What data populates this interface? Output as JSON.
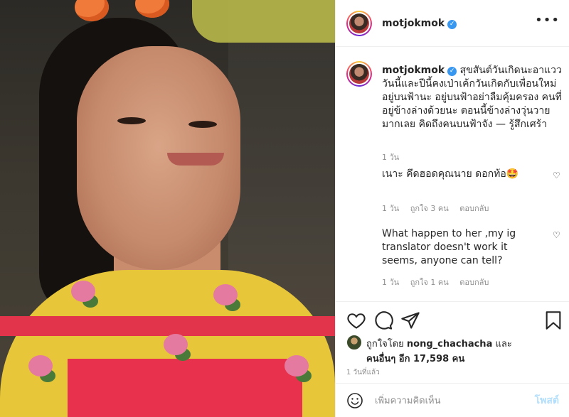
{
  "post": {
    "username": "motjokmok",
    "verified": true,
    "more_icon": "more-horizontal-icon"
  },
  "caption": {
    "username": "motjokmok",
    "text": "สุขสันต์วันเกิดนะอาแวว วันนี้และปีนี้คงเป่าเค้กวันเกิดกับเพื่อนใหม่อยู่บนฟ้านะ อยู่บนฟ้าอย่าลืมคุ้มครอง คนที่อยู่ข้างล่างด้วยนะ ตอนนี้ข้างล่างวุ่นวายมากเลย คิดถึงคนบนฟ้าจัง — รู้สึกเศร้า",
    "time": "1 วัน"
  },
  "comments": [
    {
      "text": "เนาะ คึดฮอดคุณนาย ดอกท้อ🤩",
      "time": "1 วัน",
      "likes": "ถูกใจ 3 คน",
      "reply": "ตอบกลับ"
    },
    {
      "text": "What happen to her ,my ig translator doesn't work it seems, anyone can tell?",
      "time": "1 วัน",
      "likes": "ถูกใจ 1 คน",
      "reply": "ตอบกลับ"
    }
  ],
  "likes": {
    "liked_by_prefix": "ถูกใจโดย",
    "liked_by_user": "nong_chachacha",
    "and": "และ",
    "others": "คนอื่นๆ อีก 17,598 คน"
  },
  "post_time": "1 วันที่แล้ว",
  "add_comment": {
    "placeholder": "เพิ่มความคิดเห็น",
    "post_label": "โพสต์"
  },
  "colors": {
    "verified": "#3897f0",
    "post_button_disabled": "#b2dffc",
    "muted": "#8e8e8e"
  }
}
